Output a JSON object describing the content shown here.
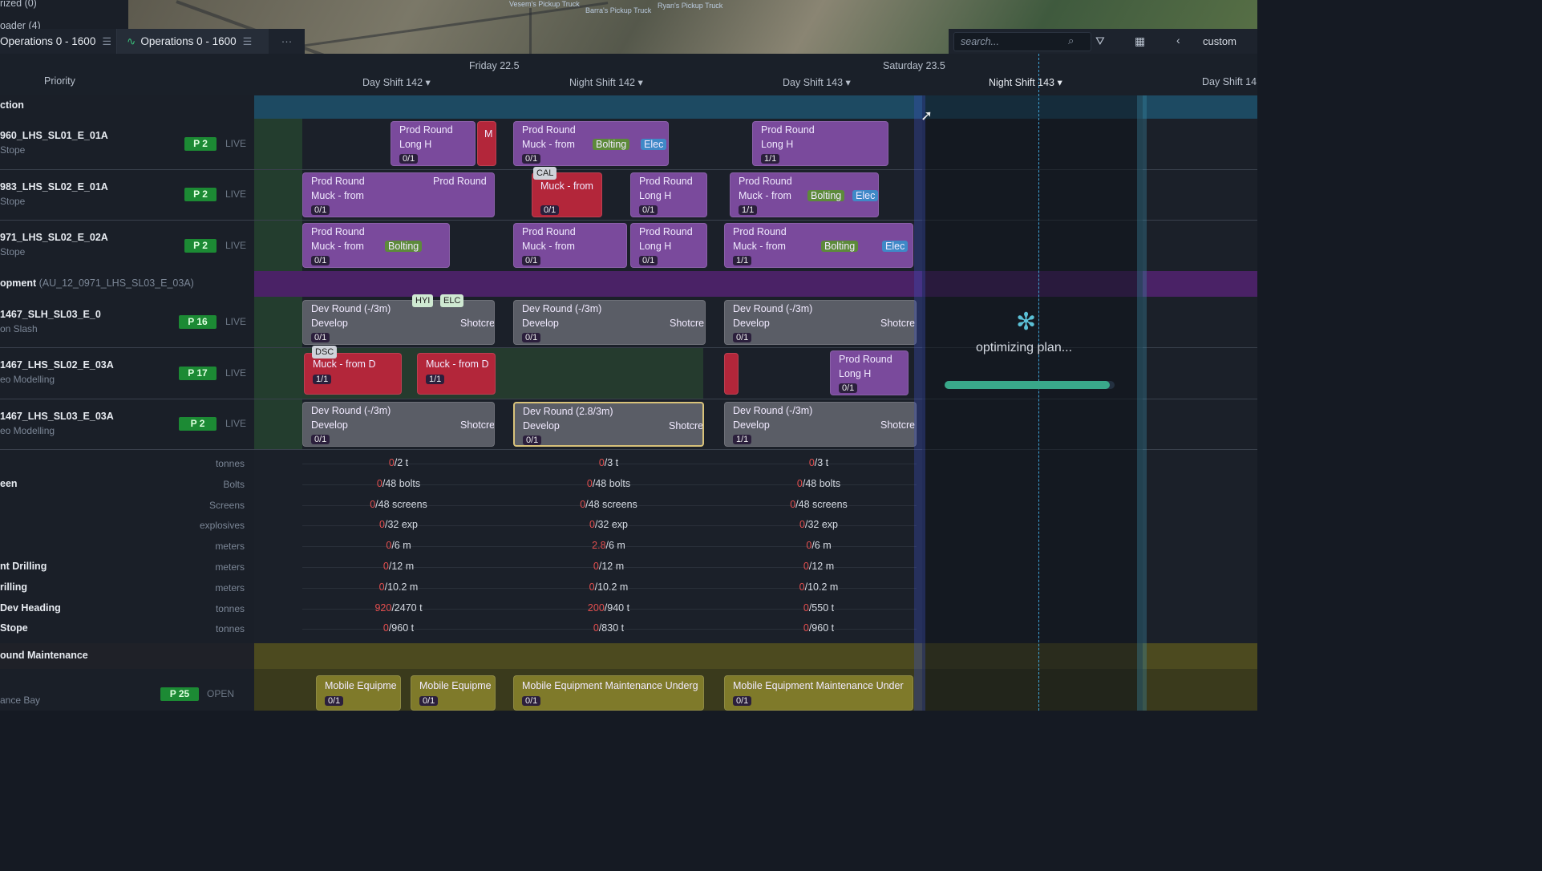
{
  "top_tabs": [
    {
      "label": "Operations 0 - 1600",
      "active": false
    },
    {
      "label": "Operations 0 - 1600",
      "active": true
    }
  ],
  "left_truncated": {
    "line1": "rized (0)",
    "line2": "oader (4)"
  },
  "map_labels": [
    "Vesem's Pickup Truck",
    "Barra's Pickup Truck",
    "Ryan's Pickup Truck"
  ],
  "toolbar": {
    "search_placeholder": "search...",
    "custom_label": "custom"
  },
  "header": {
    "priority_label": "Priority",
    "days": [
      {
        "label": "Friday 22.5"
      },
      {
        "label": "Saturday 23.5"
      }
    ],
    "shifts": [
      {
        "label": "Day Shift 142 ▾"
      },
      {
        "label": "Night Shift 142 ▾"
      },
      {
        "label": "Day Shift 143 ▾"
      },
      {
        "label": "Night Shift 143 ▾"
      },
      {
        "label": "Day Shift 14"
      }
    ]
  },
  "sections": [
    {
      "label": "ction"
    },
    {
      "label": "opment",
      "sub": "(AU_12_0971_LHS_SL03_E_03A)"
    },
    {
      "label": "ound Maintenance"
    }
  ],
  "rows": [
    {
      "name": "960_LHS_SL01_E_01A",
      "sub": "Stope",
      "priority": "P 2",
      "status": "LIVE"
    },
    {
      "name": "983_LHS_SL02_E_01A",
      "sub": "Stope",
      "priority": "P 2",
      "status": "LIVE"
    },
    {
      "name": "971_LHS_SL02_E_02A",
      "sub": "Stope",
      "priority": "P 2",
      "status": "LIVE"
    },
    {
      "name": "1467_SLH_SL03_E_0",
      "sub": "on Slash",
      "priority": "P 16",
      "status": "LIVE"
    },
    {
      "name": "1467_LHS_SL02_E_03A",
      "sub": "eo Modelling",
      "priority": "P 17",
      "status": "LIVE"
    },
    {
      "name": "1467_LHS_SL03_E_03A",
      "sub": "eo Modelling",
      "priority": "P 2",
      "status": "LIVE"
    },
    {
      "name": "",
      "sub": "ance Bay",
      "priority": "P 25",
      "status": "OPEN"
    }
  ],
  "cards": {
    "prod_round": "Prod Round",
    "long_h": "Long H",
    "muck_from": "Muck - from",
    "bolting": "Bolting",
    "elec": "Elec",
    "dev_round": "Dev Round (-/3m)",
    "dev_round_2": "Dev Round (2.8/3m)",
    "develop": "Develop",
    "shotcre": "Shotcre",
    "muck_from_d": "Muck - from D",
    "mobile_eq": "Mobile Equipme",
    "mobile_eq_long": "Mobile Equipment Maintenance Underg",
    "mobile_eq_long2": "Mobile Equipment Maintenance Under",
    "zero_one": "0/1",
    "one_one": "1/1",
    "chips": {
      "cal": "CAL",
      "hyi": "HYI",
      "elc": "ELC",
      "dsc": "DSC"
    }
  },
  "metrics": [
    {
      "label": "",
      "unit": "tonnes",
      "values": [
        {
          "r": "0",
          "t": "/2 t"
        },
        {
          "r": "0",
          "t": "/3 t"
        },
        {
          "r": "0",
          "t": "/3 t"
        }
      ]
    },
    {
      "label": "een",
      "unit": "Bolts",
      "values": [
        {
          "r": "0",
          "t": "/48 bolts"
        },
        {
          "r": "0",
          "t": "/48 bolts"
        },
        {
          "r": "0",
          "t": "/48 bolts"
        }
      ]
    },
    {
      "label": "",
      "unit": "Screens",
      "values": [
        {
          "r": "0",
          "t": "/48 screens"
        },
        {
          "r": "0",
          "t": "/48 screens"
        },
        {
          "r": "0",
          "t": "/48 screens"
        }
      ]
    },
    {
      "label": "",
      "unit": "explosives",
      "values": [
        {
          "r": "0",
          "t": "/32 exp"
        },
        {
          "r": "0",
          "t": "/32 exp"
        },
        {
          "r": "0",
          "t": "/32 exp"
        }
      ]
    },
    {
      "label": "",
      "unit": "meters",
      "values": [
        {
          "r": "0",
          "t": "/6 m"
        },
        {
          "r": "2.8",
          "t": "/6 m"
        },
        {
          "r": "0",
          "t": "/6 m"
        }
      ]
    },
    {
      "label": "nt Drilling",
      "unit": "meters",
      "values": [
        {
          "r": "0",
          "t": "/12 m"
        },
        {
          "r": "0",
          "t": "/12 m"
        },
        {
          "r": "0",
          "t": "/12 m"
        }
      ]
    },
    {
      "label": "rilling",
      "unit": "meters",
      "values": [
        {
          "r": "0",
          "t": "/10.2 m"
        },
        {
          "r": "0",
          "t": "/10.2 m"
        },
        {
          "r": "0",
          "t": "/10.2 m"
        }
      ]
    },
    {
      "label": "Dev Heading",
      "unit": "tonnes",
      "values": [
        {
          "r": "920",
          "t": "/2470 t"
        },
        {
          "r": "200",
          "t": "/940 t"
        },
        {
          "r": "0",
          "t": "/550 t"
        }
      ]
    },
    {
      "label": "Stope",
      "unit": "tonnes",
      "values": [
        {
          "r": "0",
          "t": "/960 t"
        },
        {
          "r": "0",
          "t": "/830 t"
        },
        {
          "r": "0",
          "t": "/960 t"
        }
      ]
    }
  ],
  "optimizer": {
    "label": "optimizing plan...",
    "progress": 0.97
  },
  "colors": {
    "accent_green": "#1c8a34",
    "card_purple": "#7a4a9c",
    "card_red": "#b3263a",
    "now_line": "#3fa3d6",
    "progress": "#39a88a"
  }
}
